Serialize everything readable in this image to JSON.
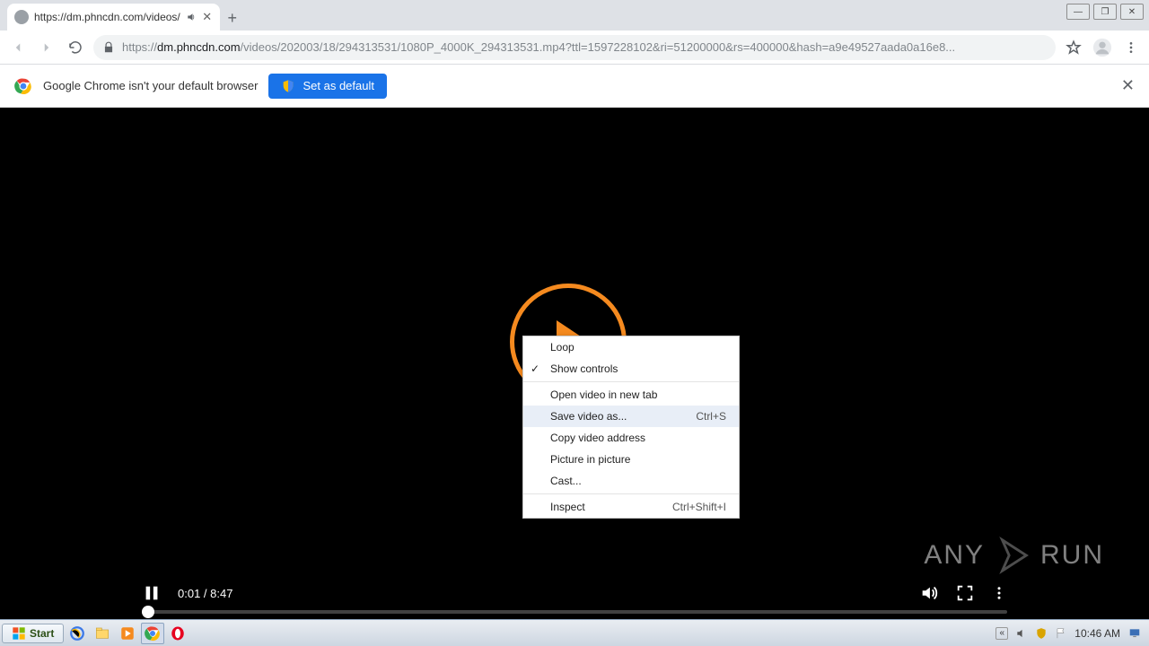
{
  "tab": {
    "title": "https://dm.phncdn.com/videos/"
  },
  "window_controls": {
    "min": "—",
    "max": "❐",
    "close": "✕"
  },
  "toolbar": {
    "url_prefix": "https://",
    "url_host": "dm.phncdn.com",
    "url_path": "/videos/202003/18/294313531/1080P_4000K_294313531.mp4?ttl=1597228102&ri=51200000&rs=400000&hash=a9e49527aada0a16e8..."
  },
  "infobar": {
    "message": "Google Chrome isn't your default browser",
    "button": "Set as default"
  },
  "context_menu": {
    "items": [
      {
        "label": "Loop",
        "checked": false
      },
      {
        "label": "Show controls",
        "checked": true
      },
      {
        "sep": true
      },
      {
        "label": "Open video in new tab"
      },
      {
        "label": "Save video as...",
        "shortcut": "Ctrl+S",
        "hover": true
      },
      {
        "label": "Copy video address"
      },
      {
        "label": "Picture in picture"
      },
      {
        "label": "Cast..."
      },
      {
        "sep": true
      },
      {
        "label": "Inspect",
        "shortcut": "Ctrl+Shift+I"
      }
    ]
  },
  "video": {
    "current_time": "0:01",
    "duration": "8:47",
    "separator": " / "
  },
  "watermark": {
    "left": "ANY",
    "right": "RUN"
  },
  "taskbar": {
    "start": "Start",
    "clock": "10:46 AM"
  }
}
